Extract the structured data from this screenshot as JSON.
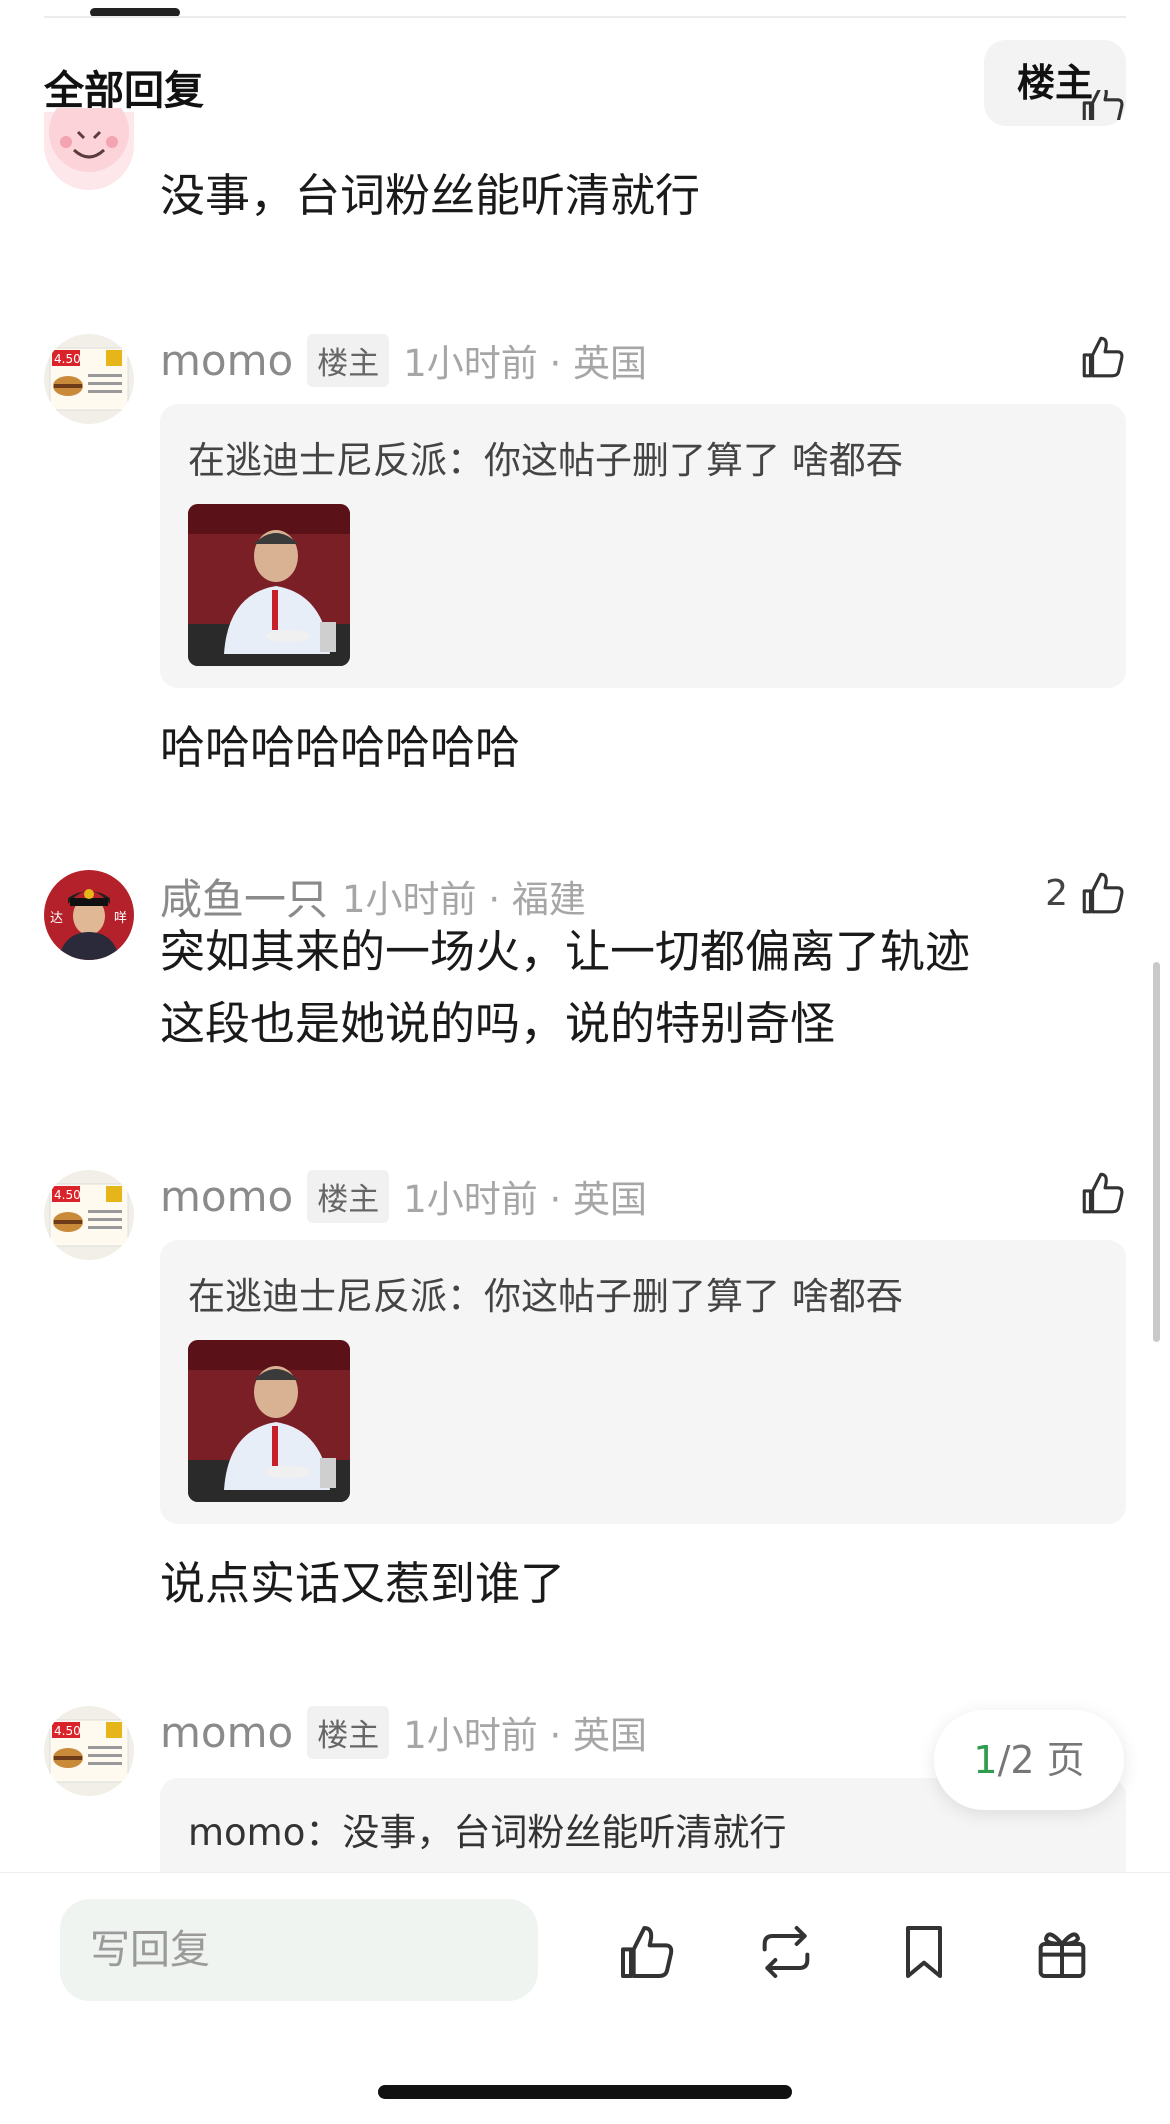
{
  "header": {
    "title": "全部回复",
    "filter_label": "楼主"
  },
  "comments": [
    {
      "content": [
        "没事，台词粉丝能听清就行"
      ]
    },
    {
      "author": "momo",
      "op_badge": "楼主",
      "time": "1小时前 · 英国",
      "quote": {
        "text": "在逃迪士尼反派：你这帖子删了算了 啥都吞",
        "has_image": true
      },
      "content": [
        "哈哈哈哈哈哈哈哈"
      ]
    },
    {
      "author": "咸鱼一只",
      "time": "1小时前 · 福建",
      "likes": "2",
      "content": [
        "突如其来的一场火，让一切都偏离了轨迹",
        "这段也是她说的吗，说的特别奇怪"
      ]
    },
    {
      "author": "momo",
      "op_badge": "楼主",
      "time": "1小时前 · 英国",
      "quote": {
        "text": "在逃迪士尼反派：你这帖子删了算了 啥都吞",
        "has_image": true
      },
      "content": [
        "说点实话又惹到谁了"
      ]
    },
    {
      "author": "momo",
      "op_badge": "楼主",
      "time": "1小时前 · 英国",
      "quote": {
        "text": "momo：没事，台词粉丝能听清就行"
      }
    }
  ],
  "pagination": {
    "current": "1",
    "rest": "/2 页"
  },
  "bottom_bar": {
    "reply_placeholder": "写回复",
    "icons": [
      "thumbs-up-icon",
      "repost-icon",
      "bookmark-icon",
      "gift-icon"
    ]
  },
  "colors": {
    "accent_green": "#2e9d4d",
    "muted_text": "#a6a6a6",
    "quote_bg": "#f5f5f5"
  }
}
